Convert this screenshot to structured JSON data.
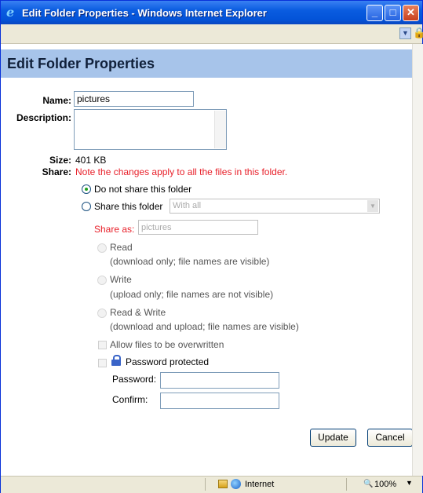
{
  "window": {
    "title": "Edit Folder Properties - Windows Internet Explorer",
    "minimize_glyph": "_",
    "maximize_glyph": "□",
    "close_glyph": "✕"
  },
  "page": {
    "heading": "Edit Folder Properties",
    "name_label": "Name:",
    "name_value": "pictures",
    "description_label": "Description:",
    "description_value": "",
    "size_label": "Size:",
    "size_value": "401 KB",
    "share_label": "Share:",
    "share_note": "Note the changes apply to all the files in this folder.",
    "option_no_share": "Do not share this folder",
    "option_share": "Share this folder",
    "share_with_value": "With all",
    "share_as_label": "Share as:",
    "share_as_value": "pictures",
    "perm_read_title": "Read",
    "perm_read_desc": "(download only; file names are visible)",
    "perm_write_title": "Write",
    "perm_write_desc": "(upload only; file names are not visible)",
    "perm_rw_title": "Read & Write",
    "perm_rw_desc": "(download and upload; file names are visible)",
    "allow_overwrite": "Allow files to be overwritten",
    "password_protected": "Password protected",
    "password_label": "Password:",
    "confirm_label": "Confirm:",
    "update_button": "Update",
    "cancel_button": "Cancel"
  },
  "status": {
    "zone": "Internet",
    "zoom": "100%"
  },
  "icons": [
    "ie-logo-icon",
    "lock-icon",
    "chevron-down-icon",
    "padlock-icon",
    "globe-icon",
    "zoom-icon"
  ],
  "colors": {
    "title_bar": "#0a5ce0",
    "header_band": "#a7c4ea",
    "note_red": "#e8202a"
  }
}
